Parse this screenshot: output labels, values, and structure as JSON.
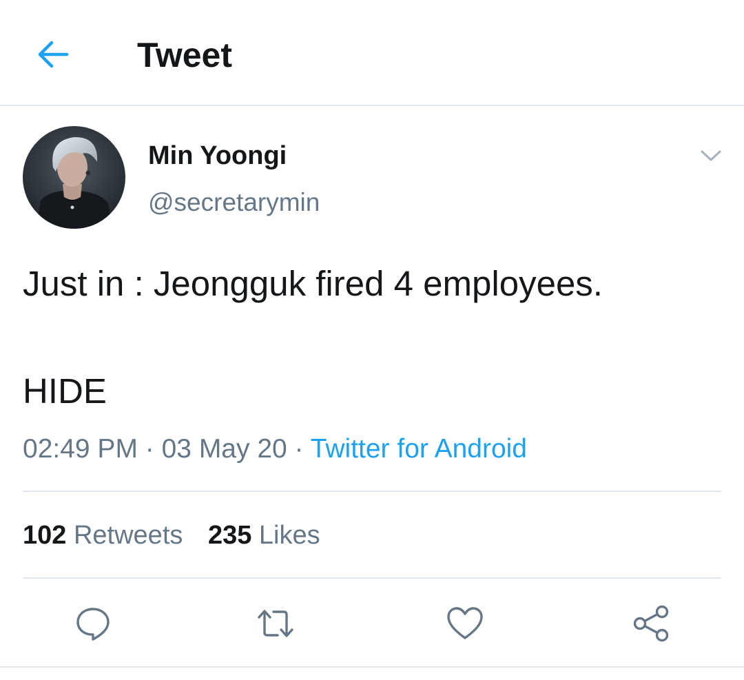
{
  "header": {
    "title": "Tweet",
    "back_icon": "arrow-left-icon"
  },
  "tweet": {
    "author": {
      "display_name": "Min Yoongi",
      "handle": "@secretarymin"
    },
    "text_line_1": "Just in : Jeongguk fired 4 employees.",
    "text_line_2": "HIDE",
    "time": "02:49 PM",
    "separator": " · ",
    "date": "03 May 20",
    "source": "Twitter for Android",
    "retweets_count": "102",
    "retweets_label": "Retweets",
    "likes_count": "235",
    "likes_label": "Likes"
  },
  "actions": [
    "reply-icon",
    "retweet-icon",
    "like-icon",
    "share-icon"
  ],
  "colors": {
    "accent": "#1da1f2",
    "text_primary": "#14171a",
    "text_secondary": "#657786",
    "divider": "#e1e8ed"
  }
}
